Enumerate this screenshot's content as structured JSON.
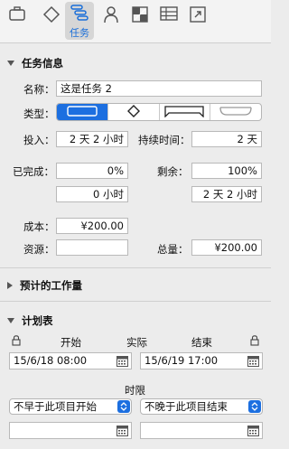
{
  "toolbar": {
    "active_tab_label": "任务",
    "tabs": [
      "inspector-doc-icon",
      "diamond-icon",
      "task-bars-icon",
      "person-icon",
      "checker-icon",
      "table-icon",
      "export-icon"
    ]
  },
  "task_info": {
    "header": "任务信息",
    "name_label": "名称：",
    "name_value": "这是任务 2",
    "type_label": "类型：",
    "effort_label": "投入：",
    "effort_value": "2 天 2 小时",
    "duration_label": "持续时间：",
    "duration_value": "2 天",
    "completed_label": "已完成：",
    "completed_pct": "0%",
    "completed_time": "0 小时",
    "remaining_label": "剩余：",
    "remaining_pct": "100%",
    "remaining_time": "2 天 2 小时",
    "cost_label": "成本：",
    "cost_value": "¥200.00",
    "resources_label": "资源：",
    "resources_value": "",
    "total_label": "总量：",
    "total_value": "¥200.00"
  },
  "estimated_work": {
    "header": "预计的工作量"
  },
  "schedule": {
    "header": "计划表",
    "start_label": "开始",
    "actual_label": "实际",
    "end_label": "结束",
    "start_value": "15/6/18 08:00",
    "end_value": "15/6/19 17:00",
    "deadline_label": "时限",
    "start_constraint": "不早于此项目开始",
    "end_constraint": "不晚于此项目结束",
    "start_deadline_value": "",
    "end_deadline_value": ""
  },
  "colors": {
    "accent": "#1c6fe0"
  }
}
